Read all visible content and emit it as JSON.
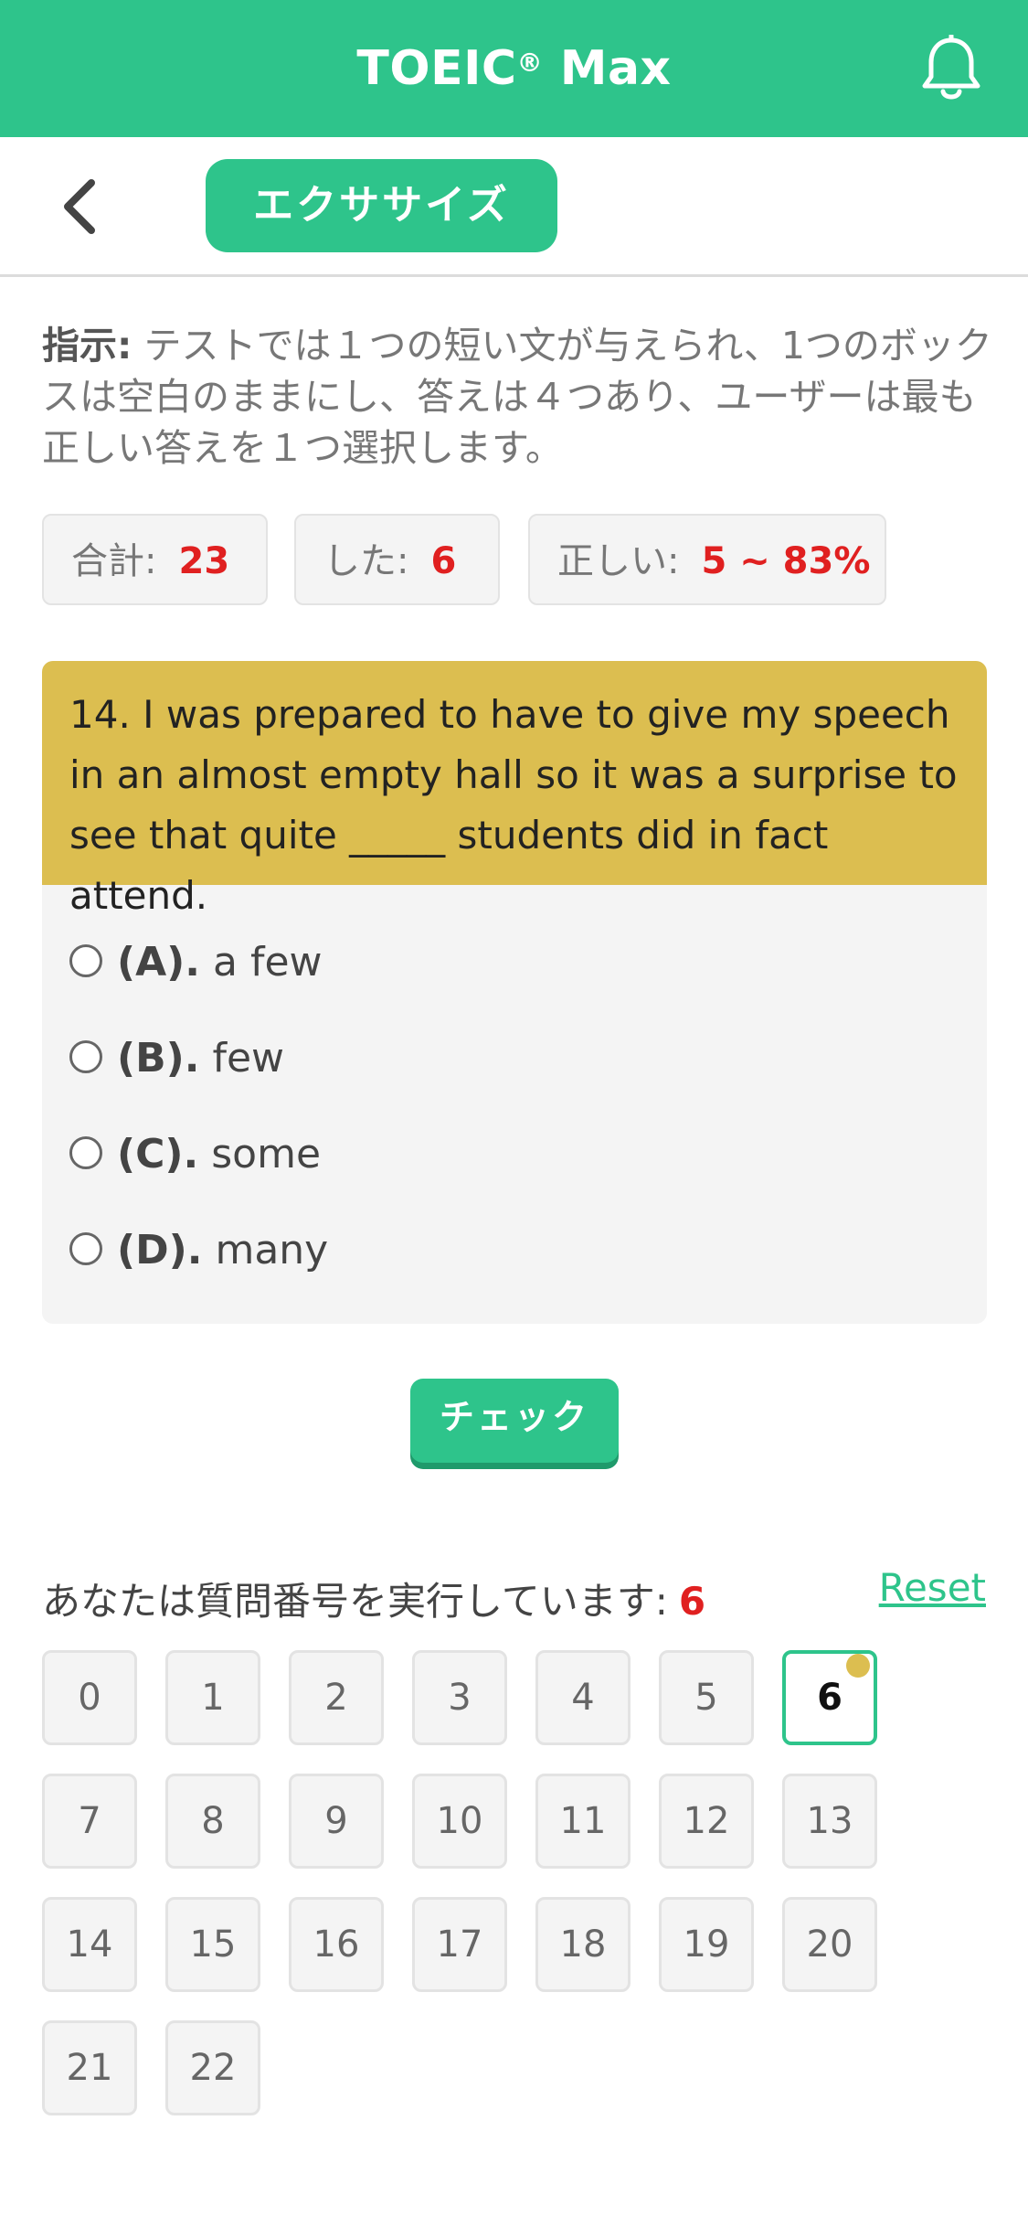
{
  "app": {
    "title": "TOEIC",
    "title_sup": "®",
    "title_suffix": " Max",
    "accent_color": "#2ec48b",
    "bell_icon": "bell-icon"
  },
  "nav": {
    "back_icon": "chevron-left-icon",
    "tab_label": "エクササイズ"
  },
  "instructions": {
    "label": "指示:",
    "text": " テストでは１つの短い文が与えられ、1つのボックスは空白のままにし、答えは４つあり、ユーザーは最も正しい答えを１つ選択します。"
  },
  "stats": {
    "total_label": "合計:",
    "total_value": "23",
    "done_label": "した:",
    "done_value": "6",
    "correct_label": "正しい:",
    "correct_value": "5 ~ 83%"
  },
  "question": {
    "text": "14. I was prepared to have to give my speech in an almost empty hall so it was a surprise to see that quite _____ students did in fact attend.",
    "header_color": "#dcbe50",
    "options": [
      {
        "letter": "(A).",
        "text": "a few",
        "selected": false
      },
      {
        "letter": "(B).",
        "text": "few",
        "selected": false
      },
      {
        "letter": "(C).",
        "text": "some",
        "selected": false
      },
      {
        "letter": "(D).",
        "text": "many",
        "selected": false
      }
    ]
  },
  "check_label": "チェック",
  "progress": {
    "label": "あなたは質問番号を実行しています:",
    "current": "6",
    "reset_label": "Reset"
  },
  "numbers": [
    "0",
    "1",
    "2",
    "3",
    "4",
    "5",
    "6",
    "7",
    "8",
    "9",
    "10",
    "11",
    "12",
    "13",
    "14",
    "15",
    "16",
    "17",
    "18",
    "19",
    "20",
    "21",
    "22"
  ],
  "active_number": "6",
  "active_dot_color": "#dcbe50"
}
